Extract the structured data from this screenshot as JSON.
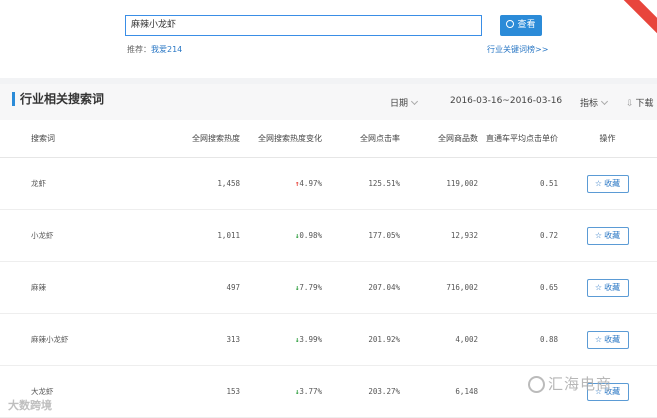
{
  "search": {
    "value": "麻辣小龙虾",
    "button_label": "查看",
    "recommend_label": "推荐：",
    "recommend_link": "我爱214",
    "industry_link": "行业关键词榜>>"
  },
  "panel": {
    "title": "行业相关搜索词",
    "date_label": "日期",
    "date_range": "2016-03-16~2016-03-16",
    "metric_label": "指标",
    "download_label": "下载"
  },
  "table": {
    "headers": [
      "搜索词",
      "全网搜索热度",
      "全网搜索热度变化",
      "全网点击率",
      "全网商品数",
      "直通车平均点击单价",
      "操作"
    ],
    "rows": [
      {
        "keyword": "龙虾",
        "heat": "1,458",
        "change": "4.97%",
        "dir": "up",
        "ctr": "125.51%",
        "goods": "119,002",
        "cpc": "0.51",
        "action": "收藏"
      },
      {
        "keyword": "小龙虾",
        "heat": "1,011",
        "change": "0.98%",
        "dir": "down",
        "ctr": "177.05%",
        "goods": "12,932",
        "cpc": "0.72",
        "action": "收藏"
      },
      {
        "keyword": "麻辣",
        "heat": "497",
        "change": "7.79%",
        "dir": "down",
        "ctr": "207.04%",
        "goods": "716,002",
        "cpc": "0.65",
        "action": "收藏"
      },
      {
        "keyword": "麻辣小龙虾",
        "heat": "313",
        "change": "3.99%",
        "dir": "down",
        "ctr": "201.92%",
        "goods": "4,002",
        "cpc": "0.88",
        "action": "收藏"
      },
      {
        "keyword": "大龙虾",
        "heat": "153",
        "change": "3.77%",
        "dir": "down",
        "ctr": "203.27%",
        "goods": "6,148",
        "cpc": "",
        "action": "收藏"
      }
    ]
  },
  "watermarks": {
    "left": "大数跨境",
    "right": "汇海电商"
  },
  "colors": {
    "accent": "#2b8bd8",
    "link": "#2b78c5",
    "up": "#e8453c",
    "down": "#2a9d3a"
  }
}
